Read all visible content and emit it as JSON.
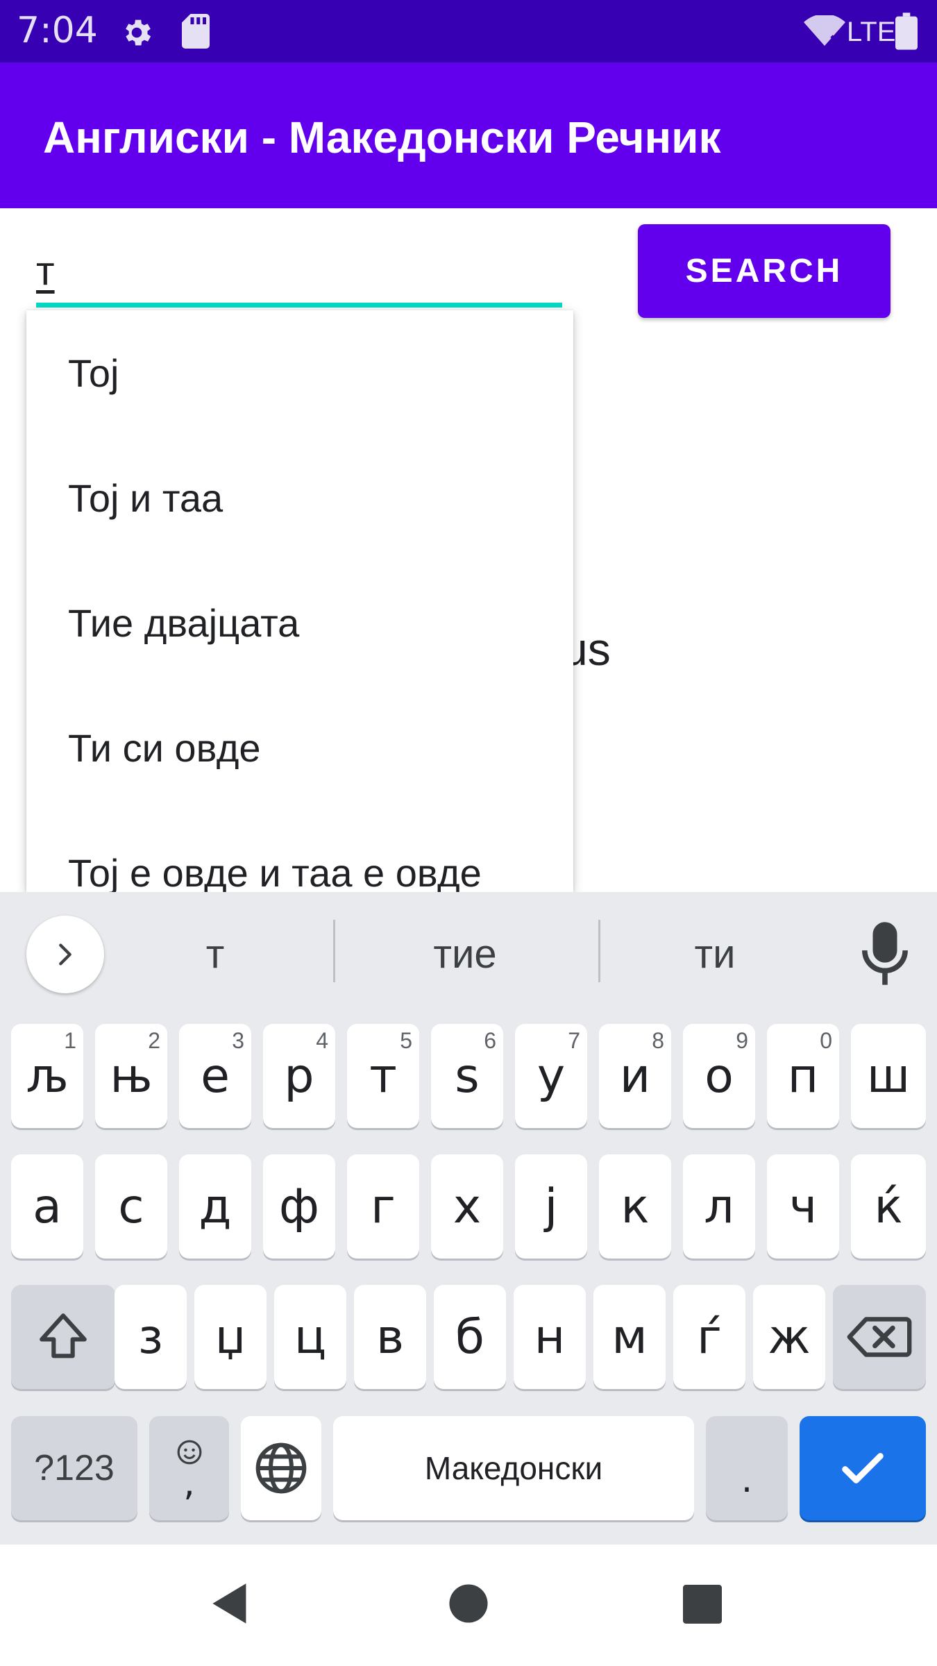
{
  "status_bar": {
    "time": "7:04",
    "network": "LTE",
    "icons": [
      "gear-icon",
      "sd-card-icon",
      "wifi-icon",
      "battery-icon"
    ]
  },
  "app_bar": {
    "title": "Англиски - Македонски Речник"
  },
  "search": {
    "value": "т",
    "button_label": "SEARCH"
  },
  "content": {
    "result_fragment": "us"
  },
  "dropdown": {
    "items": [
      "Тој",
      "Тој и таа",
      "Тие двајцата",
      "Ти си овде",
      "Тој е овде и таа е овде"
    ]
  },
  "keyboard": {
    "suggestions": [
      "т",
      "тие",
      "ти"
    ],
    "row1": [
      {
        "label": "љ",
        "hint": "1"
      },
      {
        "label": "њ",
        "hint": "2"
      },
      {
        "label": "е",
        "hint": "3"
      },
      {
        "label": "р",
        "hint": "4"
      },
      {
        "label": "т",
        "hint": "5"
      },
      {
        "label": "ѕ",
        "hint": "6"
      },
      {
        "label": "у",
        "hint": "7"
      },
      {
        "label": "и",
        "hint": "8"
      },
      {
        "label": "о",
        "hint": "9"
      },
      {
        "label": "п",
        "hint": "0"
      },
      {
        "label": "ш",
        "hint": ""
      }
    ],
    "row2": [
      "а",
      "с",
      "д",
      "ф",
      "г",
      "х",
      "ј",
      "к",
      "л",
      "ч",
      "ќ"
    ],
    "row3": [
      "з",
      "џ",
      "ц",
      "в",
      "б",
      "н",
      "м",
      "ѓ",
      "ж"
    ],
    "symbols_label": "?123",
    "comma_label": ",",
    "space_label": "Македонски",
    "period_label": "."
  },
  "colors": {
    "status_bar": "#3700b3",
    "primary": "#6200ee",
    "accent": "#03dac5",
    "keyboard_bg": "#e8eaed",
    "enter_key": "#1a73e8"
  },
  "nav_bar": {
    "icons": [
      "back-icon",
      "home-icon",
      "recents-icon"
    ]
  }
}
